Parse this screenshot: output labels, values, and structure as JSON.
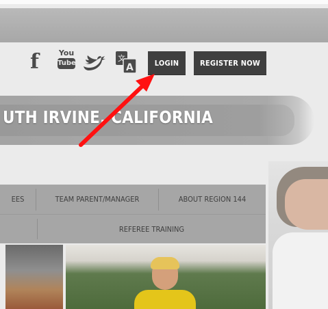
{
  "header": {
    "social": {
      "facebook_glyph": "f",
      "youtube_top": "You",
      "youtube_bottom": "Tube"
    },
    "buttons": {
      "login": "LOGIN",
      "register": "REGISTER NOW"
    }
  },
  "banner": {
    "title": "UTH IRVINE, CALIFORNIA"
  },
  "nav": {
    "row1": [
      "EES",
      "TEAM PARENT/MANAGER",
      "ABOUT REGION 144"
    ],
    "row2": [
      "REFEREE TRAINING"
    ]
  },
  "annotation": {
    "arrow_color": "#ff1111"
  },
  "colors": {
    "button_bg": "#3f3f3f",
    "nav_bg": "#a6a6a6",
    "banner_bg": "#a4a4a4"
  }
}
